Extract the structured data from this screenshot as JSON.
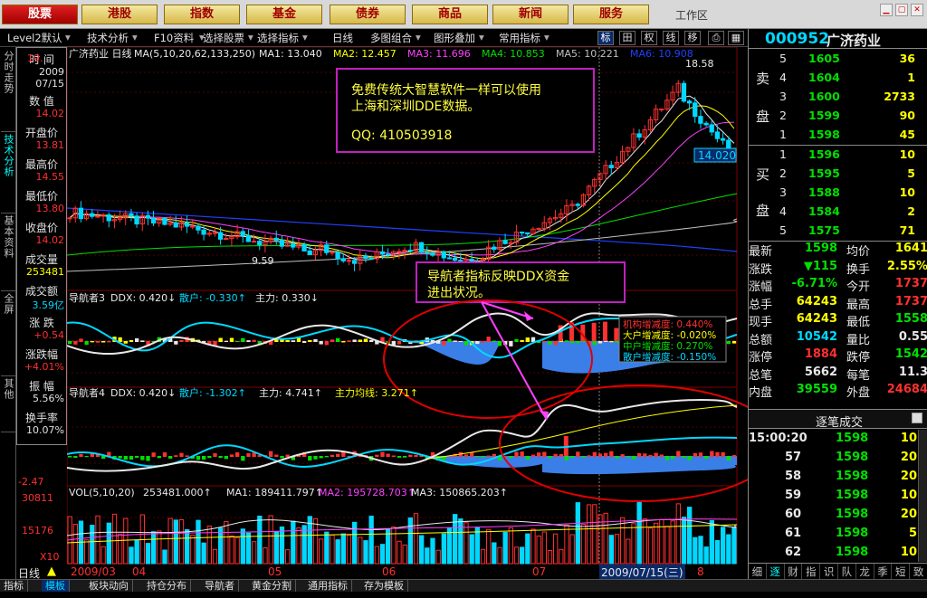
{
  "nav": [
    {
      "label": "股票",
      "active": true
    },
    {
      "label": "港股"
    },
    {
      "label": "指数"
    },
    {
      "label": "基金"
    },
    {
      "label": "债券"
    },
    {
      "label": "商品"
    },
    {
      "label": "新闻"
    },
    {
      "label": "服务"
    }
  ],
  "workzone": "工作区",
  "toolbar": [
    "Level2默认",
    "技术分析",
    "F10资料",
    "选择股票",
    "选择指标",
    "日线",
    "多图组合",
    "图形叠加",
    "常用指标"
  ],
  "toolbar_icons": [
    "标",
    "田",
    "权",
    "线",
    "移"
  ],
  "vtabs": [
    "分时走势",
    "技术分析",
    "基本资料",
    "全屏",
    "其他"
  ],
  "info": [
    {
      "label": "时  间",
      "value": "2009",
      "value2": "07/15",
      "color": "#e0e0e0"
    },
    {
      "label": "数  值",
      "value": "14.02",
      "color": "#ff3030"
    },
    {
      "label": "开盘价",
      "value": "13.81",
      "color": "#ff3030"
    },
    {
      "label": "最高价",
      "value": "14.55",
      "color": "#ff3030"
    },
    {
      "label": "最低价",
      "value": "13.80",
      "color": "#ff3030"
    },
    {
      "label": "收盘价",
      "value": "14.02",
      "color": "#ff3030"
    },
    {
      "label": "成交量",
      "value": "253481",
      "color": "#ffff00"
    },
    {
      "label": "成交额",
      "value": "3.59亿",
      "color": "#00d8ff"
    },
    {
      "label": "涨  跌",
      "value": "+0.54",
      "color": "#ff3030"
    },
    {
      "label": "涨跌幅",
      "value": "+4.01%",
      "color": "#ff3030"
    },
    {
      "label": "振  幅",
      "value": "5.56%",
      "color": "#e0e0e0"
    },
    {
      "label": "换手率",
      "value": "10.07%",
      "color": "#e0e0e0"
    }
  ],
  "chart": {
    "main_title": "广济药业 日线",
    "ma_params": "MA(5,10,20,62,133,250)",
    "ma": [
      {
        "label": "MA1: 13.040",
        "color": "#e8e8e8"
      },
      {
        "label": "MA2: 12.457",
        "color": "#ffff00"
      },
      {
        "label": "MA3: 11.696",
        "color": "#ff40ff"
      },
      {
        "label": "MA4: 10.853",
        "color": "#00e000"
      },
      {
        "label": "MA5: 10.221",
        "color": "#c0c0c0"
      },
      {
        "label": "MA6: 10.908",
        "color": "#2040ff"
      }
    ],
    "high_label": "18.58",
    "low_label": "9.59",
    "price_tag": "14.020",
    "left_axis": {
      "top_label": "19.",
      "ind_low": "-2.47",
      "vol_top": "30811",
      "vol_mid": "15176",
      "vol_unit": "X10"
    },
    "ann1_line1": "免费传统大智慧软件一样可以使用",
    "ann1_line2": "上海和深圳DDE数据。",
    "ann1_qq": "QQ: 410503918",
    "ann2": "导航者指标反映DDX资金进出状况。",
    "ind1": {
      "name": "导航者3",
      "ddx": "DDX: 0.420↓",
      "sanhu": "散户: -0.330↑",
      "zhuli": "主力: 0.330↓"
    },
    "ind2": {
      "name": "导航者4",
      "ddx": "DDX: 0.420↓",
      "sanhu": "散户: -1.302↑",
      "zhuli": "主力: 4.741↑",
      "avg": "主力均线: 3.271↑"
    },
    "vol": {
      "params": "VOL(5,10,20)",
      "value": "253481.000↑",
      "ma1": "MA1: 189411.797↑",
      "ma2": "MA2: 195728.703↑",
      "ma3": "MA3: 150865.203↑"
    },
    "legend": [
      {
        "label": "机构增减度: 0.440%",
        "color": "#ff3030"
      },
      {
        "label": "大户增减度: -0.020%",
        "color": "#ffff00"
      },
      {
        "label": "中户增减度: 0.270%",
        "color": "#00e000"
      },
      {
        "label": "散户增减度: -0.150%",
        "color": "#00d8ff"
      }
    ]
  },
  "datebar": {
    "period": "日线",
    "dates": [
      "2009/03",
      "04",
      "05",
      "06",
      "07"
    ],
    "cursor": "2009/07/15(三)",
    "last": "8"
  },
  "stock": {
    "code": "000952",
    "name": "广济药业"
  },
  "sell": [
    {
      "n": "5",
      "price": "1605",
      "vol": "36"
    },
    {
      "n": "4",
      "price": "1604",
      "vol": "1"
    },
    {
      "n": "3",
      "price": "1600",
      "vol": "2733"
    },
    {
      "n": "2",
      "price": "1599",
      "vol": "90"
    },
    {
      "n": "1",
      "price": "1598",
      "vol": "45"
    }
  ],
  "buy": [
    {
      "n": "1",
      "price": "1596",
      "vol": "10"
    },
    {
      "n": "2",
      "price": "1595",
      "vol": "5"
    },
    {
      "n": "3",
      "price": "1588",
      "vol": "10"
    },
    {
      "n": "4",
      "price": "1584",
      "vol": "2"
    },
    {
      "n": "5",
      "price": "1575",
      "vol": "71"
    }
  ],
  "sell_label": [
    "卖",
    "盘"
  ],
  "buy_label": [
    "买",
    "盘"
  ],
  "stats": [
    {
      "k1": "最新",
      "v1": "1598",
      "c1": "#00e000",
      "k2": "均价",
      "v2": "1641",
      "c2": "#ffff00"
    },
    {
      "k1": "涨跌",
      "v1": "▼115",
      "c1": "#00e000",
      "k2": "换手",
      "v2": "2.55%",
      "c2": "#ffff00"
    },
    {
      "k1": "涨幅",
      "v1": "-6.71%",
      "c1": "#00e000",
      "k2": "今开",
      "v2": "1737",
      "c2": "#ff3030"
    },
    {
      "k1": "总手",
      "v1": "64243",
      "c1": "#ffff00",
      "k2": "最高",
      "v2": "1737",
      "c2": "#ff3030"
    },
    {
      "k1": "现手",
      "v1": "64243",
      "c1": "#ffff00",
      "k2": "最低",
      "v2": "1558",
      "c2": "#00e000"
    },
    {
      "k1": "总额",
      "v1": "10542",
      "c1": "#00d8ff",
      "k2": "量比",
      "v2": "0.55",
      "c2": "#e8e8e8"
    },
    {
      "k1": "涨停",
      "v1": "1884",
      "c1": "#ff3030",
      "k2": "跌停",
      "v2": "1542",
      "c2": "#00e000"
    },
    {
      "k1": "总笔",
      "v1": "5662",
      "c1": "#e8e8e8",
      "k2": "每笔",
      "v2": "11.3",
      "c2": "#e8e8e8"
    },
    {
      "k1": "内盘",
      "v1": "39559",
      "c1": "#00e000",
      "k2": "外盘",
      "v2": "24684",
      "c2": "#ff3030"
    }
  ],
  "trade_header": "逐笔成交",
  "trades": [
    {
      "time": "15:00:20",
      "price": "1598",
      "vol": "10"
    },
    {
      "time": "57",
      "price": "1598",
      "vol": "20"
    },
    {
      "time": "58",
      "price": "1598",
      "vol": "20"
    },
    {
      "time": "59",
      "price": "1598",
      "vol": "10"
    },
    {
      "time": "60",
      "price": "1598",
      "vol": "20"
    },
    {
      "time": "61",
      "price": "1598",
      "vol": "5"
    },
    {
      "time": "62",
      "price": "1598",
      "vol": "10"
    }
  ],
  "rp_tabs": [
    "细",
    "逐",
    "财",
    "指",
    "识",
    "队",
    "龙",
    "季",
    "短",
    "致"
  ],
  "bottom_tabs": [
    "指标",
    "模板",
    "板块动向",
    "持仓分布",
    "导航者",
    "黄金分割",
    "通用指标",
    "存为模板"
  ],
  "colors": {
    "up": "#ff3030",
    "down": "#00d8ff",
    "grid": "#800000",
    "accent": "#ffff00"
  }
}
